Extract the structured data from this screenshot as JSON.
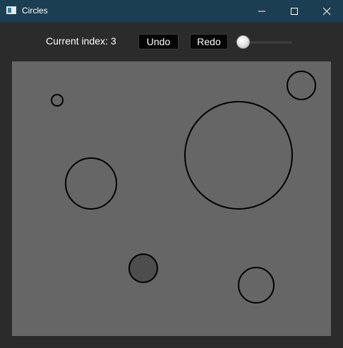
{
  "window": {
    "title": "Circles",
    "controls": [
      "minimize-icon",
      "maximize-icon",
      "close-icon"
    ]
  },
  "toolbar": {
    "index_label": "Current index: 3",
    "undo_label": "Undo",
    "redo_label": "Redo",
    "slider_value": 0
  },
  "canvas": {
    "background": "#666666",
    "circle_stroke": "#000000",
    "selected_fill": "#4d4d4d",
    "circle_count": 6,
    "selected_count": 1
  }
}
